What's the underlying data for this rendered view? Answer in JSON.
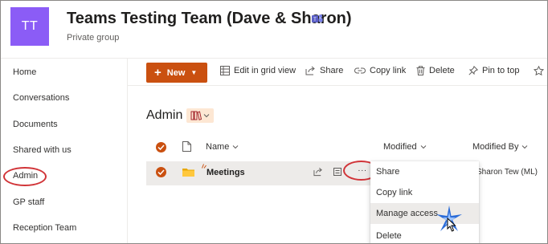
{
  "site": {
    "logo_initials": "TT",
    "title": "Teams Testing Team (Dave & Sharon)",
    "subtitle": "Private group",
    "logo_color": "#8b5cf6"
  },
  "nav": {
    "items": [
      {
        "label": "Home"
      },
      {
        "label": "Conversations"
      },
      {
        "label": "Documents"
      },
      {
        "label": "Shared with us"
      },
      {
        "label": "Admin"
      },
      {
        "label": "GP staff"
      },
      {
        "label": "Reception Team"
      }
    ]
  },
  "commandbar": {
    "new_label": "New",
    "edit_grid_label": "Edit in grid view",
    "share_label": "Share",
    "copy_link_label": "Copy link",
    "delete_label": "Delete",
    "pin_label": "Pin to top",
    "accent_color": "#ca5010"
  },
  "library": {
    "title": "Admin",
    "columns": {
      "name": "Name",
      "modified": "Modified",
      "modified_by": "Modified By"
    },
    "rows": [
      {
        "name": "Meetings",
        "modified_by": "Sharon Tew (ML)"
      }
    ]
  },
  "context_menu": {
    "items": [
      {
        "label": "Share"
      },
      {
        "label": "Copy link"
      },
      {
        "label": "Manage access"
      },
      {
        "label": "Delete"
      }
    ]
  }
}
